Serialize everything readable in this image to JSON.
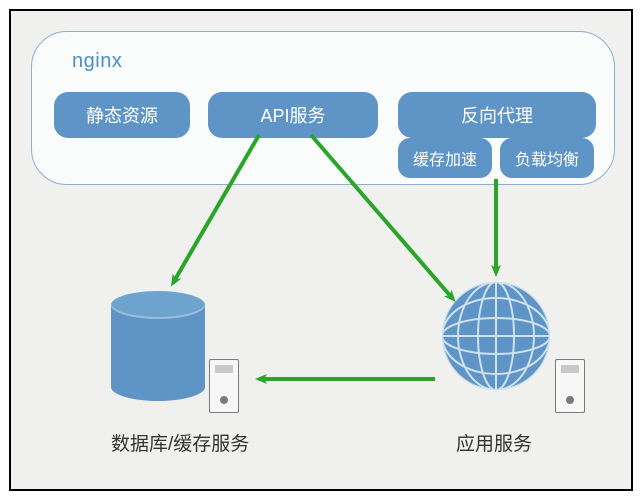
{
  "diagram": {
    "nginx": {
      "title": "nginx",
      "static_resources": "静态资源",
      "api_service": "API服务",
      "reverse_proxy": "反向代理",
      "cache_acceleration": "缓存加速",
      "load_balancing": "负载均衡"
    },
    "nodes": {
      "db_cache_label": "数据库/缓存服务",
      "app_service_label": "应用服务"
    },
    "arrows": [
      {
        "from": "api_service",
        "to": "db_cache",
        "direction": "down-left"
      },
      {
        "from": "api_service",
        "to": "app_service",
        "direction": "down-right"
      },
      {
        "from": "reverse_proxy_group",
        "to": "app_service",
        "direction": "down"
      },
      {
        "from": "app_service",
        "to": "db_cache",
        "direction": "left"
      }
    ],
    "colors": {
      "pill_fill": "#5e95c6",
      "group_border": "#8faecd",
      "arrow": "#2aa52a",
      "text_title": "#4a90c2"
    }
  }
}
